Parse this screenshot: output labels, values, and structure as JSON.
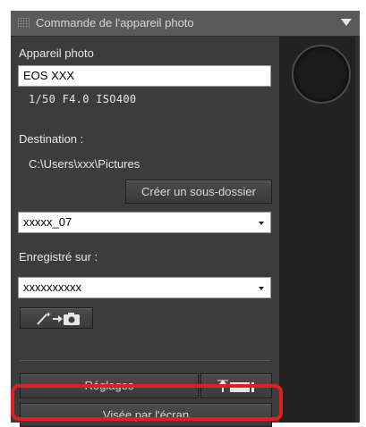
{
  "panel": {
    "title": "Commande de l'appareil photo"
  },
  "camera": {
    "section_label": "Appareil photo",
    "model": "EOS XXX",
    "settings_line": "1/50  F4.0  ISO400"
  },
  "destination": {
    "label": "Destination :",
    "path": "C:\\Users\\xxx\\Pictures",
    "subfolder_button": "Créer un sous-dossier",
    "folder_select_value": "xxxxx_07"
  },
  "saved_on": {
    "label": "Enregistré sur :",
    "select_value": "xxxxxxxxxx"
  },
  "buttons": {
    "settings": "Réglages",
    "live_view": "Visée par l'écran"
  },
  "colors": {
    "panel_bg": "#3c3c3c",
    "highlight": "#e02020"
  },
  "icons": {
    "wand_camera": "wand-to-camera-icon",
    "upload_card": "upload-to-card-icon"
  }
}
